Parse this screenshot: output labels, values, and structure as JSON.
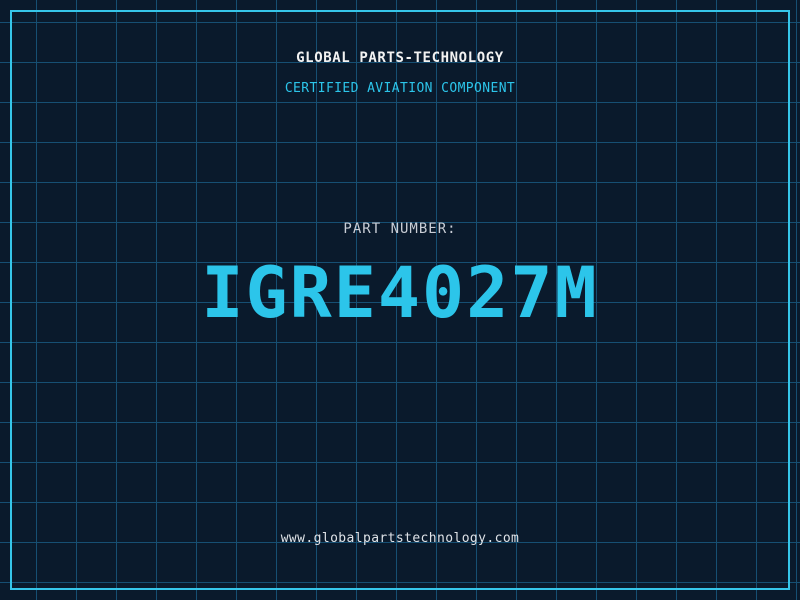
{
  "header": {
    "company": "GLOBAL PARTS-TECHNOLOGY",
    "subtitle": "CERTIFIED AVIATION COMPONENT"
  },
  "part": {
    "label": "PART NUMBER:",
    "number": "IGRE4027M"
  },
  "footer": {
    "website": "www.globalpartstechnology.com"
  },
  "colors": {
    "background": "#0a1a2c",
    "grid": "#164f73",
    "frame": "#36c5e9",
    "accent": "#2cc5ea",
    "title": "#f2f2f2",
    "label": "#c9ced6",
    "footer": "#dfe3e8"
  }
}
